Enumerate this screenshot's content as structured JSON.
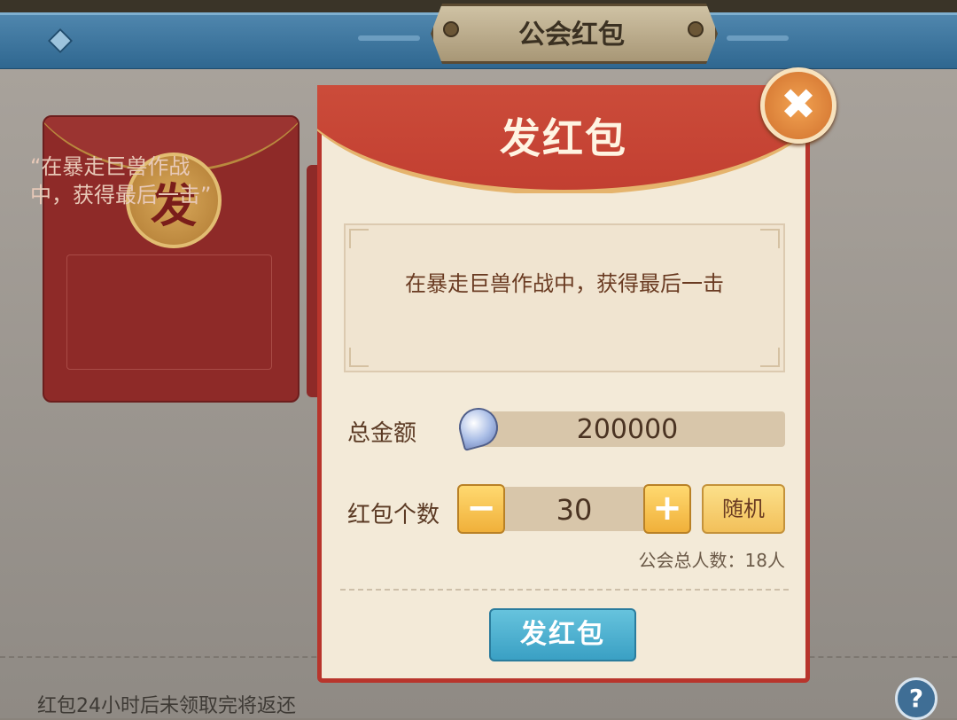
{
  "header": {
    "title": "公会红包"
  },
  "card": {
    "coin_char": "发",
    "text": "“在暴走巨兽作战中，获得最后一击”"
  },
  "modal": {
    "title": "发红包",
    "close_label": "✖",
    "message": "在暴走巨兽作战中，获得最后一击",
    "amount_label": "总金额",
    "amount_value": "200000",
    "count_label": "红包个数",
    "count_value": "30",
    "minus_label": "−",
    "plus_label": "+",
    "random_label": "随机",
    "member_count": "公会总人数：18人",
    "send_label": "发红包"
  },
  "footer": {
    "note": "红包24小时后未领取完将返还",
    "help_label": "?"
  },
  "colors": {
    "accent_red": "#c23f31",
    "button_yellow": "#f0b03a",
    "button_blue": "#3aa0c4",
    "header_blue": "#2f6790"
  },
  "icons": [
    "close-icon",
    "gem-currency-icon",
    "minus-icon",
    "plus-icon",
    "help-icon"
  ]
}
